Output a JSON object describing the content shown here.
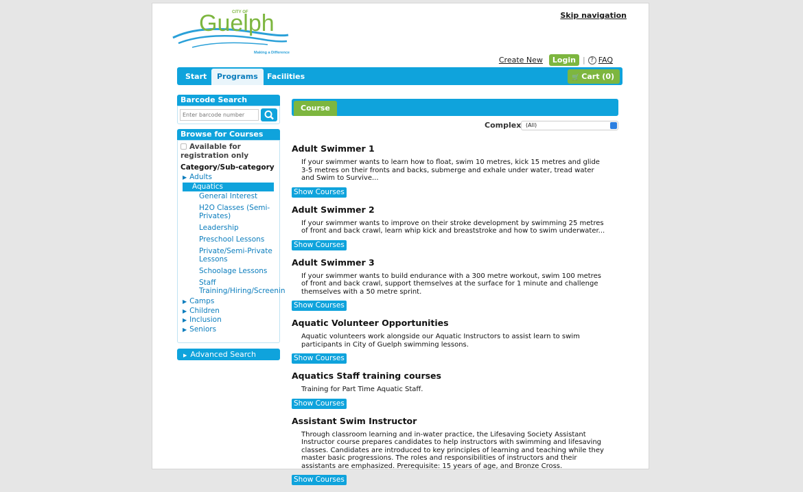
{
  "header": {
    "logo_small": "CITY OF",
    "logo_text": "Guelph",
    "tagline": "Making a Difference",
    "skip_navigation": "Skip navigation",
    "create_new": "Create New",
    "login": "Login",
    "faq": "FAQ"
  },
  "nav": {
    "tabs": [
      "Start",
      "Programs",
      "Facilities"
    ],
    "active": "Programs",
    "cart": "Cart (0)"
  },
  "sidebar": {
    "barcode_title": "Barcode Search",
    "barcode_placeholder": "Enter barcode number",
    "browse_title": "Browse for Courses",
    "available_label": "Available for registration only",
    "category_title": "Category/Sub-category",
    "categories_top": [
      "Adults"
    ],
    "selected_category": "Aquatics",
    "subcategories": [
      "General Interest",
      "H2O Classes (Semi-Privates)",
      "Leadership",
      "Preschool Lessons",
      "Private/Semi-Private Lessons",
      "Schoolage Lessons",
      "Staff Training/Hiring/Screenin"
    ],
    "categories_bottom": [
      "Camps",
      "Children",
      "Inclusion",
      "Seniors"
    ],
    "advanced_search": "Advanced Search"
  },
  "main": {
    "tab_label": "Course",
    "complex_label": "Complex",
    "complex_value": "(All)",
    "show_courses_label": "Show Courses",
    "courses": [
      {
        "title": "Adult Swimmer 1",
        "description": "If your swimmer wants to learn how to float, swim 10 metres, kick 15 metres and glide 3-5 metres on their fronts and backs, submerge and exhale under water, tread water and Swim to Survive..."
      },
      {
        "title": "Adult Swimmer 2",
        "description": "If your swimmer wants to improve on their stroke development by swimming 25 metres of front and back crawl, learn whip kick and breaststroke and how to swim underwater..."
      },
      {
        "title": "Adult Swimmer 3",
        "description": "If your swimmer wants to build endurance with a 300 metre workout, swim 100 metres of front and back crawl, support themselves at the surface for 1 minute and challenge themselves with a 50 metre sprint."
      },
      {
        "title": "Aquatic Volunteer Opportunities",
        "description": "Aquatic volunteers work alongside our Aquatic Instructors to assist learn to swim participants in City of Guelph swimming lessons."
      },
      {
        "title": "Aquatics Staff training courses",
        "description": "Training for Part Time Aquatic Staff."
      },
      {
        "title": "Assistant Swim Instructor",
        "description": "Through classroom learning and in-water practice, the Lifesaving Society Assistant Instructor course prepares candidates to help instructors with swimming and lifesaving classes. Candidates are introduced to key principles of learning and teaching while they master basic progressions. The roles and responsibilities of instructors and their assistants are emphasized. Prerequisite: 15 years of age, and Bronze Cross."
      }
    ]
  },
  "colors": {
    "primary_blue": "#0fa3dc",
    "green": "#7db63f",
    "link_blue": "#0b7dbd"
  }
}
